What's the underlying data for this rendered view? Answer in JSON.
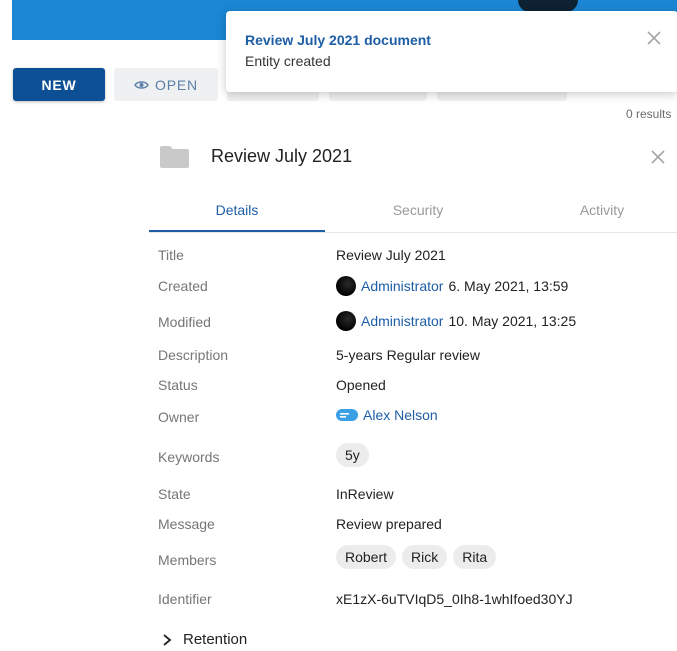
{
  "toolbar": {
    "new_label": "NEW",
    "open_label": "OPEN",
    "results_text": "0 results"
  },
  "toast": {
    "title": "Review July 2021 document",
    "message": "Entity created"
  },
  "panel": {
    "title": "Review July 2021",
    "tabs": [
      {
        "label": "Details"
      },
      {
        "label": "Security"
      },
      {
        "label": "Activity"
      }
    ],
    "fields": {
      "title": {
        "label": "Title",
        "value": "Review July 2021"
      },
      "created": {
        "label": "Created",
        "user": "Administrator",
        "date": "6. May 2021, 13:59"
      },
      "modified": {
        "label": "Modified",
        "user": "Administrator",
        "date": "10. May 2021, 13:25"
      },
      "description": {
        "label": "Description",
        "value": "5-years Regular review"
      },
      "status": {
        "label": "Status",
        "value": "Opened"
      },
      "owner": {
        "label": "Owner",
        "value": "Alex Nelson"
      },
      "keywords": {
        "label": "Keywords",
        "items": [
          "5y"
        ]
      },
      "state": {
        "label": "State",
        "value": "InReview"
      },
      "message": {
        "label": "Message",
        "value": "Review prepared"
      },
      "members": {
        "label": "Members",
        "items": [
          "Robert",
          "Rick",
          "Rita"
        ]
      },
      "identifier": {
        "label": "Identifier",
        "value": "xE1zX-6uTVIqD5_0Ih8-1whIfoed30YJ"
      }
    },
    "retention_label": "Retention"
  },
  "colors": {
    "header_blue": "#1b87d4",
    "primary": "#0c4f95",
    "link": "#1d5ea6"
  }
}
